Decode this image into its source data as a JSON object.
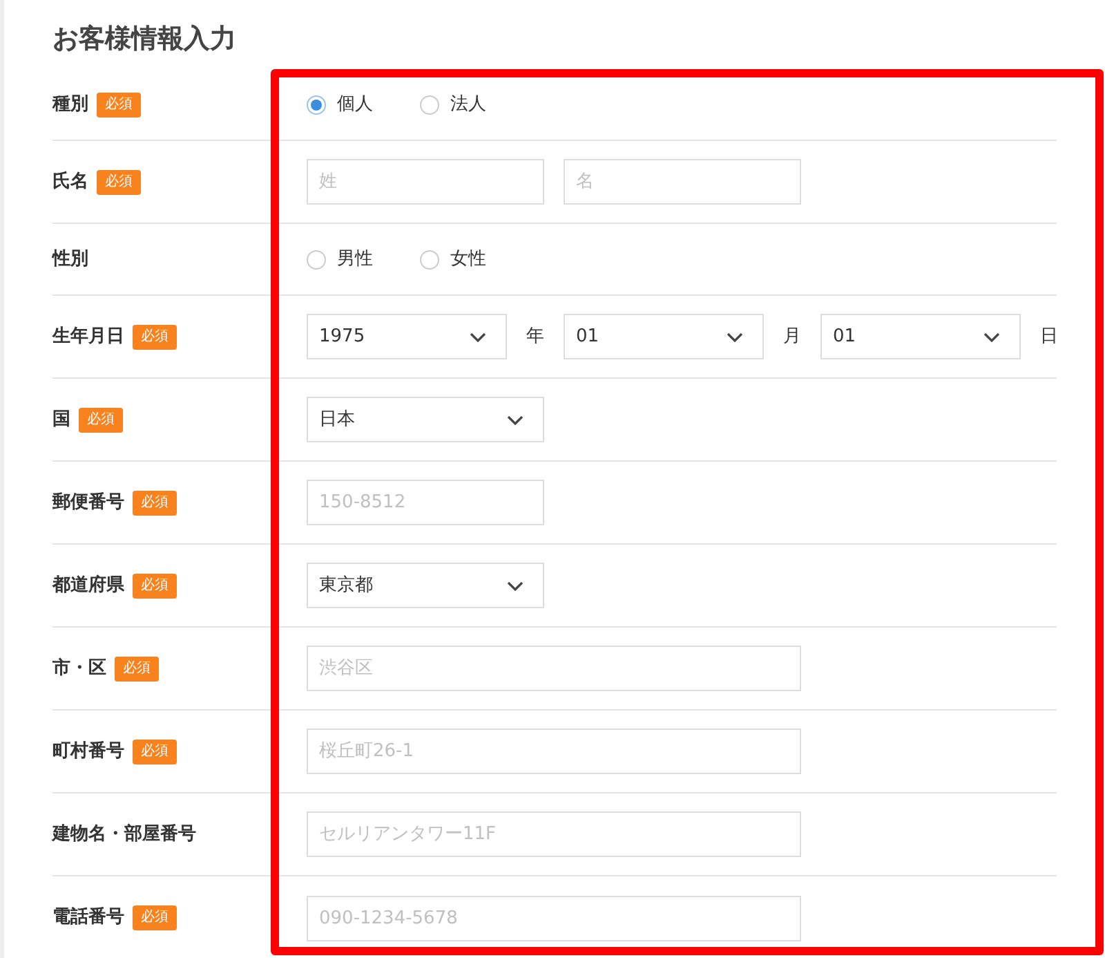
{
  "title": "お客様情報入力",
  "rows": [
    {
      "kind": "radio",
      "label": "種別",
      "badge": "必須",
      "options": [
        {
          "label": "個人",
          "selected": true
        },
        {
          "label": "法人",
          "selected": false
        }
      ]
    },
    {
      "kind": "text",
      "label": "氏名",
      "badge": "必須",
      "fields": [
        {
          "placeholder": "姓",
          "kind": "short"
        },
        {
          "placeholder": "名",
          "kind": "short"
        }
      ]
    },
    {
      "kind": "radio",
      "label": "性別",
      "options": [
        {
          "label": "男性",
          "selected": false
        },
        {
          "label": "女性",
          "selected": false
        }
      ]
    },
    {
      "kind": "date",
      "label": "生年月日",
      "badge": "必須",
      "parts": [
        {
          "value": "1975",
          "unit": "年"
        },
        {
          "value": "01",
          "unit": "月"
        },
        {
          "value": "01",
          "unit": "日"
        }
      ]
    },
    {
      "kind": "select",
      "label": "国",
      "badge": "必須",
      "value": "日本"
    },
    {
      "kind": "text",
      "label": "郵便番号",
      "badge": "必須",
      "fields": [
        {
          "placeholder": "150-8512",
          "kind": "short"
        }
      ]
    },
    {
      "kind": "select",
      "label": "都道府県",
      "badge": "必須",
      "value": "東京都"
    },
    {
      "kind": "text",
      "label": "市・区",
      "badge": "必須",
      "fields": [
        {
          "placeholder": "渋谷区",
          "kind": "long"
        }
      ]
    },
    {
      "kind": "text",
      "label": "町村番号",
      "badge": "必須",
      "fields": [
        {
          "placeholder": "桜丘町26-1",
          "kind": "long"
        }
      ]
    },
    {
      "kind": "text",
      "label": "建物名・部屋番号",
      "fields": [
        {
          "placeholder": "セルリアンタワー11F",
          "kind": "long"
        }
      ]
    },
    {
      "kind": "text",
      "label": "電話番号",
      "badge": "必須",
      "fields": [
        {
          "placeholder": "090-1234-5678",
          "kind": "long"
        }
      ]
    }
  ]
}
